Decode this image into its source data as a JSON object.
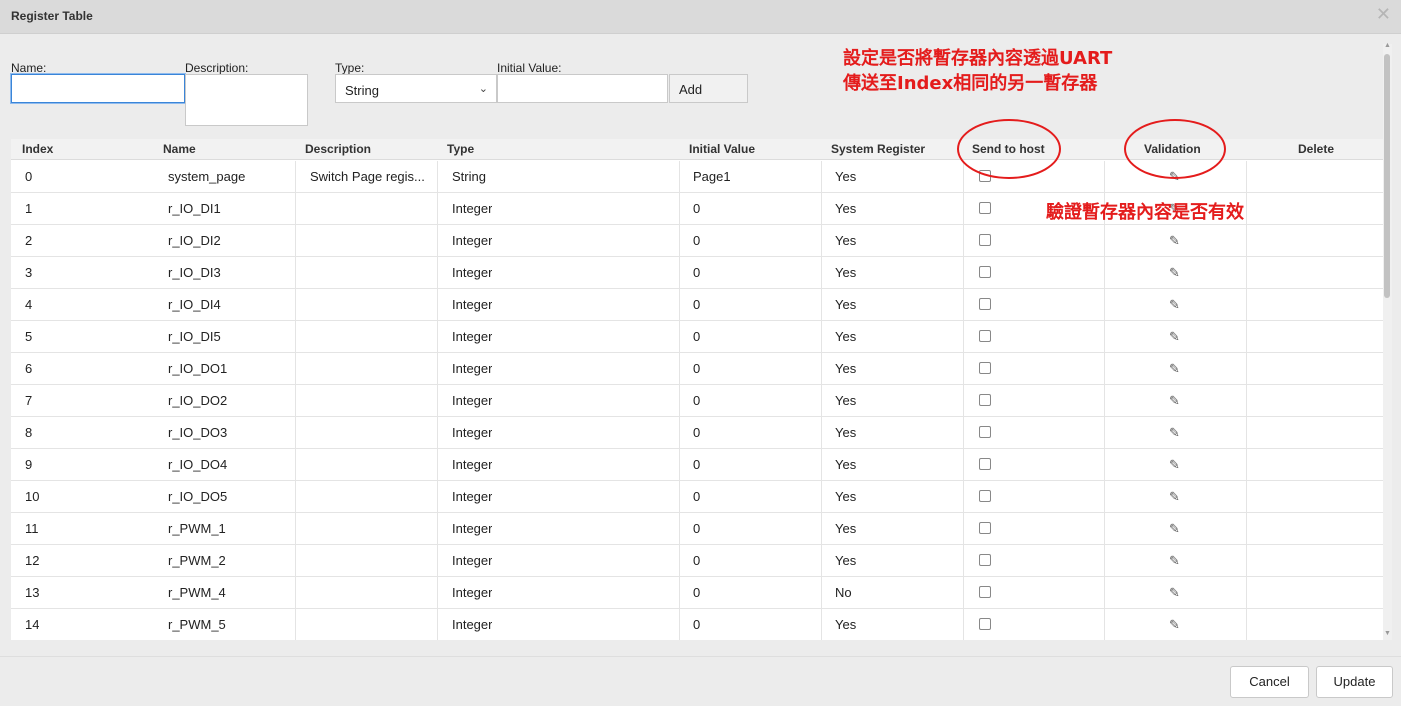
{
  "dialog": {
    "title": "Register Table",
    "close_glyph": "✕"
  },
  "form": {
    "name_label": "Name:",
    "name_value": "",
    "description_label": "Description:",
    "description_value": "",
    "type_label": "Type:",
    "type_selected": "String",
    "initial_value_label": "Initial Value:",
    "initial_value_value": "",
    "add_label": "Add"
  },
  "annotations": {
    "note1_line1": "設定是否將暫存器內容透過UART",
    "note1_line2": "傳送至Index相同的另一暫存器",
    "note2": "驗證暫存器內容是否有效",
    "color": "#e41c1c"
  },
  "table": {
    "columns": [
      "Index",
      "Name",
      "Description",
      "Type",
      "Initial Value",
      "System Register",
      "Send to host",
      "Validation",
      "Delete"
    ],
    "rows": [
      {
        "index": "0",
        "name": "system_page",
        "description": "Switch Page regis...",
        "type": "String",
        "initial": "Page1",
        "system": "Yes",
        "send_to_host": false,
        "validation_icon": "pencil-icon"
      },
      {
        "index": "1",
        "name": "r_IO_DI1",
        "description": "",
        "type": "Integer",
        "initial": "0",
        "system": "Yes",
        "send_to_host": false,
        "validation_icon": "pencil-icon"
      },
      {
        "index": "2",
        "name": "r_IO_DI2",
        "description": "",
        "type": "Integer",
        "initial": "0",
        "system": "Yes",
        "send_to_host": false,
        "validation_icon": "pencil-icon"
      },
      {
        "index": "3",
        "name": "r_IO_DI3",
        "description": "",
        "type": "Integer",
        "initial": "0",
        "system": "Yes",
        "send_to_host": false,
        "validation_icon": "pencil-icon"
      },
      {
        "index": "4",
        "name": "r_IO_DI4",
        "description": "",
        "type": "Integer",
        "initial": "0",
        "system": "Yes",
        "send_to_host": false,
        "validation_icon": "pencil-icon"
      },
      {
        "index": "5",
        "name": "r_IO_DI5",
        "description": "",
        "type": "Integer",
        "initial": "0",
        "system": "Yes",
        "send_to_host": false,
        "validation_icon": "pencil-icon"
      },
      {
        "index": "6",
        "name": "r_IO_DO1",
        "description": "",
        "type": "Integer",
        "initial": "0",
        "system": "Yes",
        "send_to_host": false,
        "validation_icon": "pencil-icon"
      },
      {
        "index": "7",
        "name": "r_IO_DO2",
        "description": "",
        "type": "Integer",
        "initial": "0",
        "system": "Yes",
        "send_to_host": false,
        "validation_icon": "pencil-icon"
      },
      {
        "index": "8",
        "name": "r_IO_DO3",
        "description": "",
        "type": "Integer",
        "initial": "0",
        "system": "Yes",
        "send_to_host": false,
        "validation_icon": "pencil-icon"
      },
      {
        "index": "9",
        "name": "r_IO_DO4",
        "description": "",
        "type": "Integer",
        "initial": "0",
        "system": "Yes",
        "send_to_host": false,
        "validation_icon": "pencil-icon"
      },
      {
        "index": "10",
        "name": "r_IO_DO5",
        "description": "",
        "type": "Integer",
        "initial": "0",
        "system": "Yes",
        "send_to_host": false,
        "validation_icon": "pencil-icon"
      },
      {
        "index": "11",
        "name": "r_PWM_1",
        "description": "",
        "type": "Integer",
        "initial": "0",
        "system": "Yes",
        "send_to_host": false,
        "validation_icon": "pencil-icon"
      },
      {
        "index": "12",
        "name": "r_PWM_2",
        "description": "",
        "type": "Integer",
        "initial": "0",
        "system": "Yes",
        "send_to_host": false,
        "validation_icon": "pencil-icon"
      },
      {
        "index": "13",
        "name": "r_PWM_4",
        "description": "",
        "type": "Integer",
        "initial": "0",
        "system": "No",
        "send_to_host": false,
        "validation_icon": "pencil-icon"
      },
      {
        "index": "14",
        "name": "r_PWM_5",
        "description": "",
        "type": "Integer",
        "initial": "0",
        "system": "Yes",
        "send_to_host": false,
        "validation_icon": "pencil-icon"
      }
    ]
  },
  "footer": {
    "cancel_label": "Cancel",
    "update_label": "Update"
  }
}
